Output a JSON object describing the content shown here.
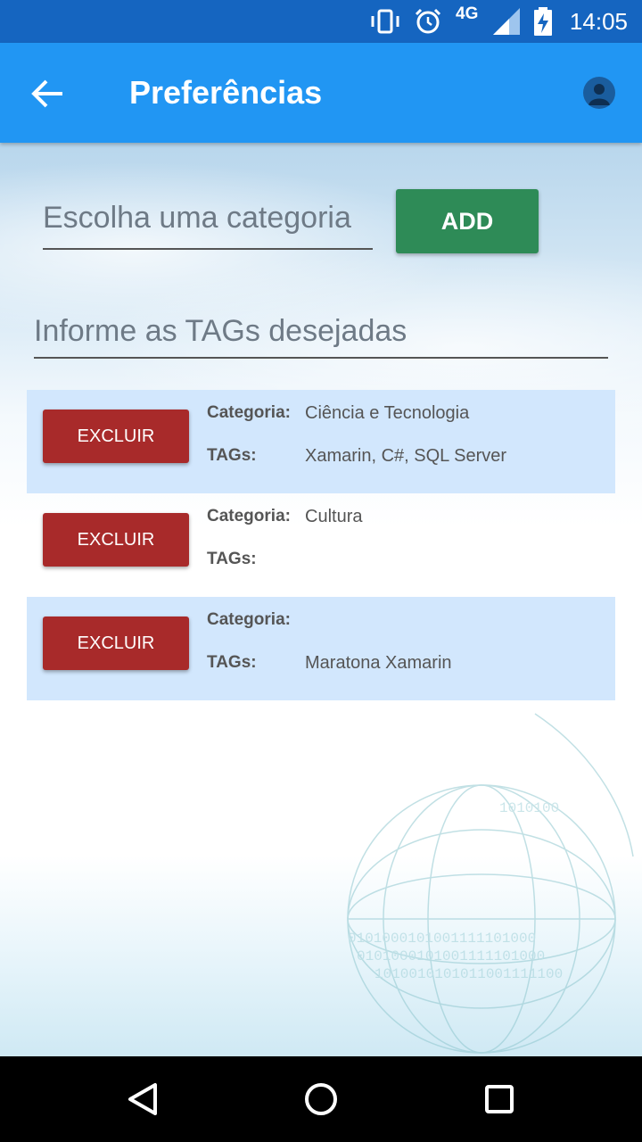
{
  "status_bar": {
    "icons": [
      "vibrate-icon",
      "alarm-icon",
      "signal-icon",
      "battery-charging-icon"
    ],
    "network": "4G",
    "time": "14:05"
  },
  "app_bar": {
    "title": "Preferências",
    "back_icon": "arrow-back-icon",
    "profile_icon": "account-icon"
  },
  "form": {
    "category_placeholder": "Escolha uma categoria",
    "category_value": "",
    "add_label": "ADD",
    "tags_placeholder": "Informe as TAGs desejadas",
    "tags_value": ""
  },
  "preferences": [
    {
      "delete_label": "EXCLUIR",
      "category_label": "Categoria:",
      "category": "Ciência e Tecnologia",
      "tags_label": "TAGs:",
      "tags": "Xamarin, C#, SQL Server"
    },
    {
      "delete_label": "EXCLUIR",
      "category_label": "Categoria:",
      "category": "Cultura",
      "tags_label": "TAGs:",
      "tags": ""
    },
    {
      "delete_label": "EXCLUIR",
      "category_label": "Categoria:",
      "category": "",
      "tags_label": "TAGs:",
      "tags": "Maratona Xamarin"
    }
  ],
  "colors": {
    "status_bar": "#1565c0",
    "app_bar": "#2196f3",
    "add_button": "#2e8b57",
    "delete_button": "#a82a2a",
    "row_highlight": "#d2e7fd"
  },
  "nav_bar": {
    "icons": [
      "back-triangle-icon",
      "home-circle-icon",
      "recents-square-icon"
    ]
  }
}
